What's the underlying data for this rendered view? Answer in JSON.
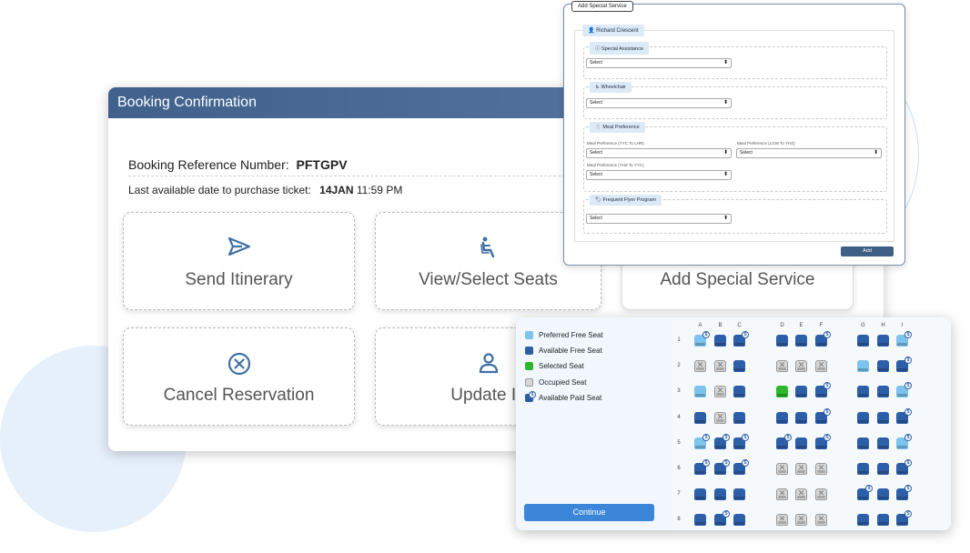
{
  "booking": {
    "title": "Booking Confirmation",
    "ref_label": "Booking Reference Number:",
    "ref_value": "PFTGPV",
    "last_label": "Last available date to purchase ticket:",
    "last_date": "14JAN",
    "last_time": "11:59 PM",
    "tiles": {
      "send": "Send Itinerary",
      "seats": "View/Select Seats",
      "special": "Add Special Service",
      "cancel": "Cancel Reservation",
      "update": "Update In"
    }
  },
  "service": {
    "title": "Add Special Service",
    "passenger": "Richard Crescent",
    "sections": {
      "assist": "Special Assistance",
      "wheelchair": "Wheelchair",
      "meal": "Meal Preference",
      "ffp": "Frequent Flyer Program"
    },
    "meal_labels": {
      "yyc_lhr": "Meal Preference (YYC To LHR)",
      "lgw_yhz": "Meal Preference (LGW To YHZ)",
      "yhz_yyc": "Meal Preference (YHZ To YYC)"
    },
    "select_placeholder": "Select",
    "add_label": "Add"
  },
  "seatmap": {
    "legend": {
      "preferred": "Preferred Free Seat",
      "available": "Available Free Seat",
      "selected": "Selected Seat",
      "occupied": "Occupied Seat",
      "paid": "Available Paid Seat"
    },
    "continue_label": "Continue",
    "columns": [
      "A",
      "B",
      "C",
      "D",
      "E",
      "F",
      "G",
      "H",
      "I"
    ],
    "rows": [
      "1",
      "2",
      "3",
      "4",
      "5",
      "6",
      "7",
      "8"
    ],
    "paid_symbol": "$",
    "seats": [
      [
        "preferred-paid",
        "available",
        "paid",
        "available",
        "available",
        "paid",
        "available",
        "available",
        "preferred-paid"
      ],
      [
        "occupied",
        "occupied",
        "available",
        "occupied",
        "occupied",
        "occupied",
        "preferred",
        "available",
        "paid"
      ],
      [
        "preferred",
        "occupied",
        "available",
        "selected",
        "available",
        "paid",
        "available",
        "available",
        "preferred-paid"
      ],
      [
        "available",
        "occupied",
        "available",
        "available",
        "available",
        "paid",
        "available",
        "available",
        "paid"
      ],
      [
        "preferred-paid",
        "paid",
        "paid",
        "paid",
        "available",
        "paid",
        "available",
        "available",
        "preferred-paid"
      ],
      [
        "paid",
        "paid",
        "paid",
        "occupied",
        "occupied",
        "occupied",
        "available",
        "available",
        "paid"
      ],
      [
        "available",
        "available",
        "available",
        "occupied",
        "occupied",
        "occupied",
        "paid",
        "available",
        "paid"
      ],
      [
        "available",
        "paid",
        "available",
        "occupied",
        "occupied",
        "occupied",
        "available",
        "available",
        "paid"
      ]
    ],
    "colors": {
      "available": "#2d5fa8",
      "preferred": "#7cc3ee",
      "selected": "#2fb62f",
      "occupied": "#d6d6d6"
    }
  }
}
